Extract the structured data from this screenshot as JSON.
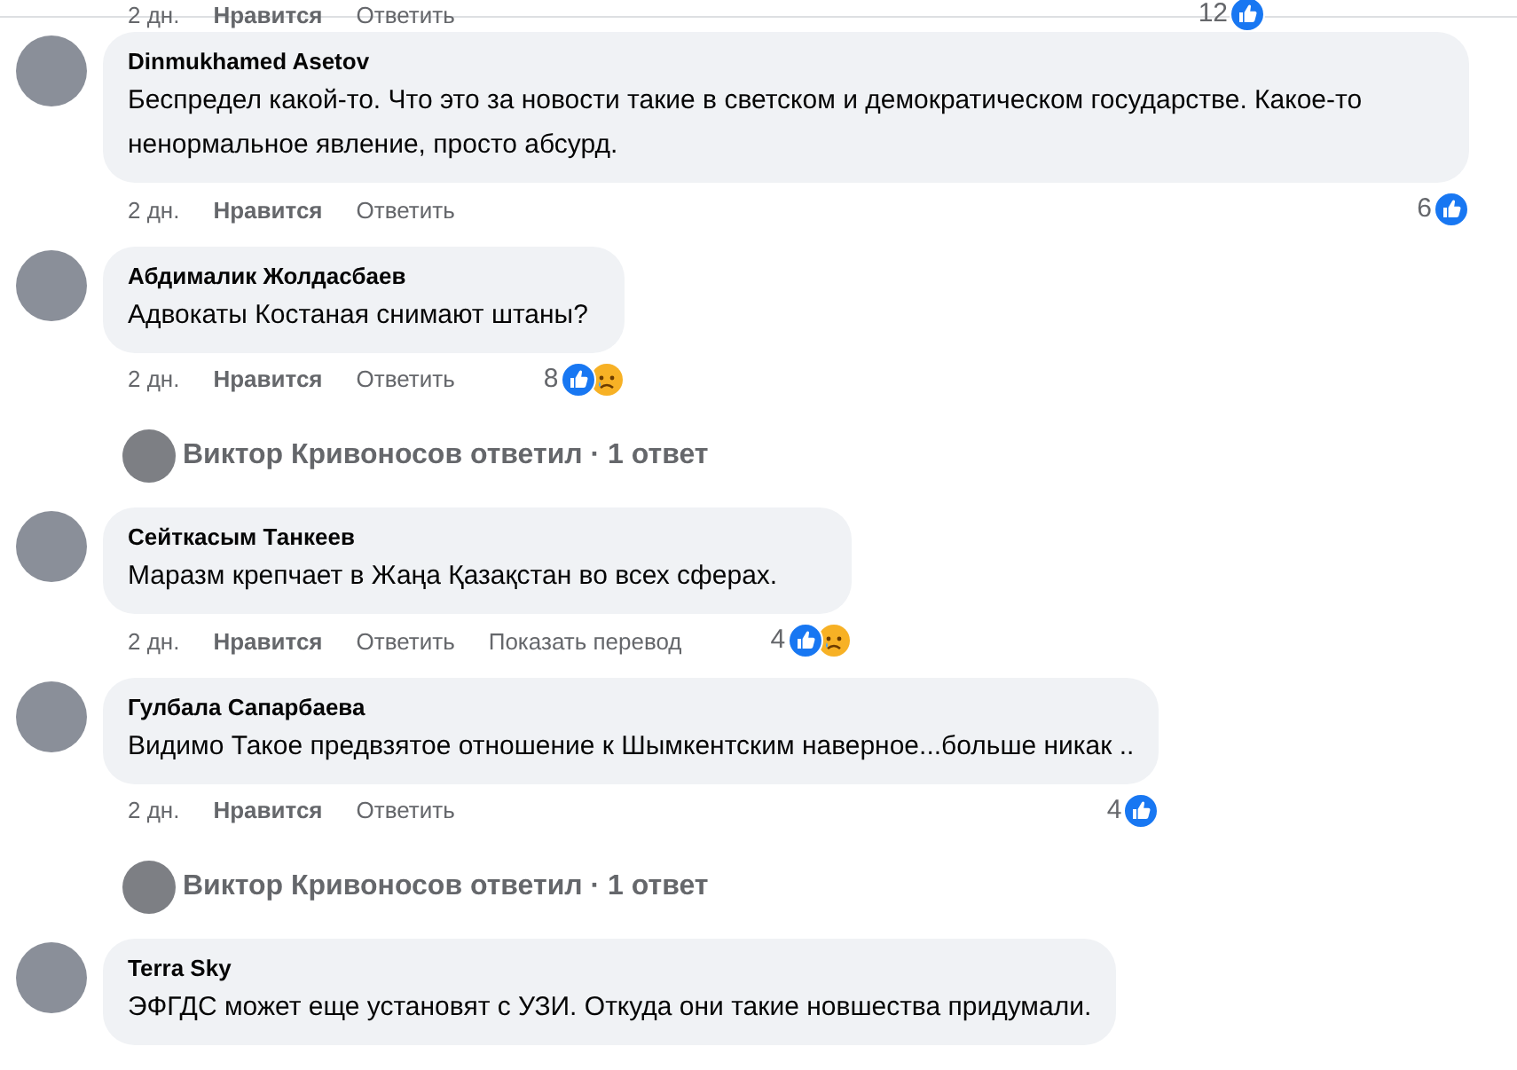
{
  "top_actions": {
    "time": "2 дн.",
    "like": "Нравится",
    "reply": "Ответить",
    "count": "12",
    "reactions": {
      "like": true,
      "sad": false
    }
  },
  "items": [
    {
      "kind": "comment",
      "author": "Dinmukhamed Asetov",
      "text": "Беспредел какой-то. Что это за новости такие в светском и демократическом государстве. Какое-то ненормальное явление, просто абсурд.",
      "actions": {
        "time": "2 дн.",
        "like": "Нравится",
        "reply": "Ответить",
        "count": "6",
        "reactions": {
          "like": true,
          "sad": false
        }
      }
    },
    {
      "kind": "comment",
      "author": "Абдималик Жолдасбаев",
      "text": "Адвокаты Костаная снимают штаны?",
      "actions": {
        "time": "2 дн.",
        "like": "Нравится",
        "reply": "Ответить",
        "count": "8",
        "reactions": {
          "like": true,
          "sad": true
        }
      }
    },
    {
      "kind": "replies",
      "text": "Виктор Кривоносов ответил · 1 ответ"
    },
    {
      "kind": "comment",
      "author": "Сейткасым Танкеев",
      "text": "Маразм крепчает в Жаңа Қазақстан во всех сферах.",
      "actions": {
        "time": "2 дн.",
        "like": "Нравится",
        "reply": "Ответить",
        "translate": "Показать перевод",
        "count": "4",
        "reactions": {
          "like": true,
          "sad": true
        }
      }
    },
    {
      "kind": "comment",
      "author": "Гулбала Сапарбаева",
      "text": "Видимо Такое предвзятое отношение к Шымкентским наверное...больше никак ..",
      "actions": {
        "time": "2 дн.",
        "like": "Нравится",
        "reply": "Ответить",
        "count": "4",
        "reactions": {
          "like": true,
          "sad": false
        }
      }
    },
    {
      "kind": "replies",
      "text": "Виктор Кривоносов ответил · 1 ответ"
    },
    {
      "kind": "comment",
      "author": "Terra Sky",
      "text": "ЭФГДС может еще установят с УЗИ. Откуда они такие новшества придумали."
    }
  ]
}
